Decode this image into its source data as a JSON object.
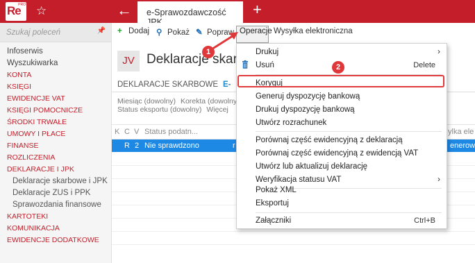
{
  "titlebar": {
    "logo_text": "Re",
    "logo_badge": "PRO",
    "tab_title": "e-Sprawozdawczość JPK",
    "accent_color": "#c41e2a",
    "icons": [
      "star-icon",
      "back-arrow-icon",
      "plus-icon"
    ]
  },
  "sidebar": {
    "search_placeholder": "Szukaj poleceń",
    "items": [
      {
        "label": "Infoserwis",
        "style": "plain"
      },
      {
        "label": "Wyszukiwarka",
        "style": "plain"
      },
      {
        "label": "KONTA",
        "style": "red"
      },
      {
        "label": "KSIĘGI",
        "style": "red"
      },
      {
        "label": "EWIDENCJE VAT",
        "style": "red"
      },
      {
        "label": "KSIĘGI POMOCNICZE",
        "style": "red"
      },
      {
        "label": "ŚRODKI TRWAŁE",
        "style": "red"
      },
      {
        "label": "UMOWY I PŁACE",
        "style": "red"
      },
      {
        "label": "FINANSE",
        "style": "red"
      },
      {
        "label": "ROZLICZENIA",
        "style": "red"
      },
      {
        "label": "DEKLARACJE I JPK",
        "style": "red"
      },
      {
        "label": "Deklaracje skarbowe i JPK",
        "style": "sub"
      },
      {
        "label": "Deklaracje ZUS i PPK",
        "style": "sub"
      },
      {
        "label": "Sprawozdania finansowe",
        "style": "sub"
      },
      {
        "label": "KARTOTEKI",
        "style": "red"
      },
      {
        "label": "KOMUNIKACJA",
        "style": "red"
      },
      {
        "label": "EWIDENCJE DODATKOWE",
        "style": "red"
      }
    ]
  },
  "toolbar": {
    "add": "Dodaj",
    "show": "Pokaż",
    "edit": "Popraw",
    "operations": "Operacje",
    "send": "Wysyłka elektroniczna"
  },
  "page": {
    "badge": "JV",
    "title": "Deklaracje skarbowe i JPK",
    "tabs": [
      "DEKLARACJE SKARBOWE",
      "E-"
    ],
    "filters": {
      "month": "Miesiąc (dowolny)",
      "correction": "Korekta (dowolny)",
      "export_status": "Status eksportu (dowolny)",
      "more": "Więcej"
    },
    "grid": {
      "headers": [
        "K",
        "C",
        "V",
        "Status podatn...",
        "ylka ele"
      ],
      "row": [
        "R",
        "2",
        "Nie sprawdzono",
        "r",
        "enerowa"
      ]
    }
  },
  "menu": {
    "items": [
      {
        "label": "Drukuj",
        "shortcut": "",
        "submenu": true
      },
      {
        "label": "Usuń",
        "shortcut": "Delete",
        "submenu": false,
        "icon": "trash-icon"
      },
      {
        "label": "Koryguj",
        "shortcut": "",
        "submenu": false,
        "highlighted": true
      },
      {
        "label": "Generuj dyspozycję bankową",
        "shortcut": "",
        "submenu": false
      },
      {
        "label": "Drukuj dyspozycję bankową",
        "shortcut": "",
        "submenu": false
      },
      {
        "label": "Utwórz rozrachunek",
        "shortcut": "",
        "submenu": false
      },
      {
        "label": "Porównaj część ewidencyjną z deklaracją",
        "shortcut": "",
        "submenu": false
      },
      {
        "label": "Porównaj część ewidencyjną z ewidencją VAT",
        "shortcut": "",
        "submenu": false
      },
      {
        "label": "Utwórz lub aktualizuj deklarację",
        "shortcut": "",
        "submenu": false
      },
      {
        "label": "Weryfikacja statusu VAT",
        "shortcut": "",
        "submenu": true
      },
      {
        "label": "Pokaż XML",
        "shortcut": "",
        "submenu": false
      },
      {
        "label": "Eksportuj",
        "shortcut": "",
        "submenu": false
      },
      {
        "label": "Załączniki",
        "shortcut": "Ctrl+B",
        "submenu": false
      }
    ]
  },
  "annotations": {
    "step1": "1",
    "step2": "2",
    "color": "#e0373a"
  }
}
